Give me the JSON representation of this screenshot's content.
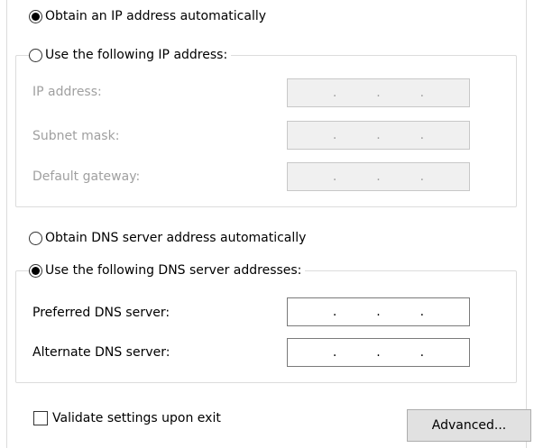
{
  "ip": {
    "auto_label": "Obtain an IP address automatically",
    "auto_checked": true,
    "manual_label": "Use the following IP address:",
    "manual_checked": false,
    "fields": [
      {
        "label": "IP address:",
        "dots": [
          ".",
          ".",
          "."
        ]
      },
      {
        "label": "Subnet mask:",
        "dots": [
          ".",
          ".",
          "."
        ]
      },
      {
        "label": "Default gateway:",
        "dots": [
          ".",
          ".",
          "."
        ]
      }
    ]
  },
  "dns": {
    "auto_label": "Obtain DNS server address automatically",
    "auto_checked": false,
    "manual_label": "Use the following DNS server addresses:",
    "manual_checked": true,
    "fields": [
      {
        "label": "Preferred DNS server:",
        "dots": [
          ".",
          ".",
          "."
        ]
      },
      {
        "label": "Alternate DNS server:",
        "dots": [
          ".",
          ".",
          "."
        ]
      }
    ]
  },
  "validate_label": "Validate settings upon exit",
  "validate_checked": false,
  "advanced_label": "Advanced..."
}
